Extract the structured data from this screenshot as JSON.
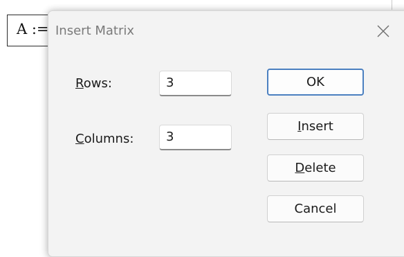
{
  "worksheet": {
    "math_expression": "A :="
  },
  "dialog": {
    "title": "Insert Matrix",
    "close_icon": "close-icon",
    "rows": {
      "label_mnemonic": "R",
      "label_rest": "ows:",
      "value": "3"
    },
    "columns": {
      "label_mnemonic": "C",
      "label_rest": "olumns:",
      "value": "3"
    },
    "buttons": {
      "ok": {
        "label": "OK"
      },
      "insert": {
        "mnemonic": "I",
        "rest": "nsert"
      },
      "delete": {
        "mnemonic": "D",
        "rest": "elete"
      },
      "cancel": {
        "label": "Cancel"
      }
    }
  },
  "colors": {
    "dialog_bg": "#f3f3f3",
    "default_button_border": "#4a7fc0",
    "title_text": "#7a7a7a"
  }
}
